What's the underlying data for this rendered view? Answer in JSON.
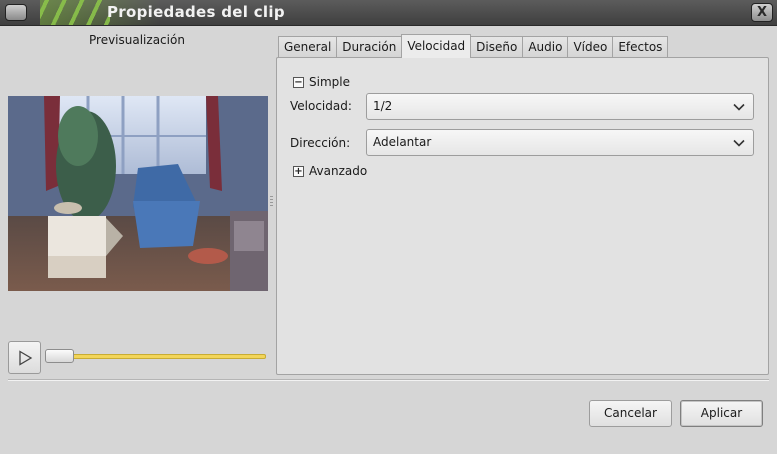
{
  "window": {
    "title": "Propiedades del clip",
    "close_glyph": "X"
  },
  "preview": {
    "label": "Previsualización",
    "seek_position": 0.0
  },
  "tabs": [
    {
      "label": "General",
      "active": false
    },
    {
      "label": "Duración",
      "active": false
    },
    {
      "label": "Velocidad",
      "active": true
    },
    {
      "label": "Diseño",
      "active": false
    },
    {
      "label": "Audio",
      "active": false
    },
    {
      "label": "Vídeo",
      "active": false
    },
    {
      "label": "Efectos",
      "active": false
    }
  ],
  "speed_panel": {
    "simple": {
      "label": "Simple",
      "expanded": true,
      "toggle_glyph": "−"
    },
    "speed_label": "Velocidad:",
    "speed_value": "1/2",
    "direction_label": "Dirección:",
    "direction_value": "Adelantar",
    "advanced": {
      "label": "Avanzado",
      "expanded": false,
      "toggle_glyph": "+"
    }
  },
  "buttons": {
    "cancel": "Cancelar",
    "apply": "Aplicar"
  },
  "colors": {
    "titlebar_accent": "#8bc34a",
    "seek_track": "#f2d55a"
  },
  "icons": {
    "play": "play-icon",
    "dropdown": "chevron-down-icon"
  }
}
